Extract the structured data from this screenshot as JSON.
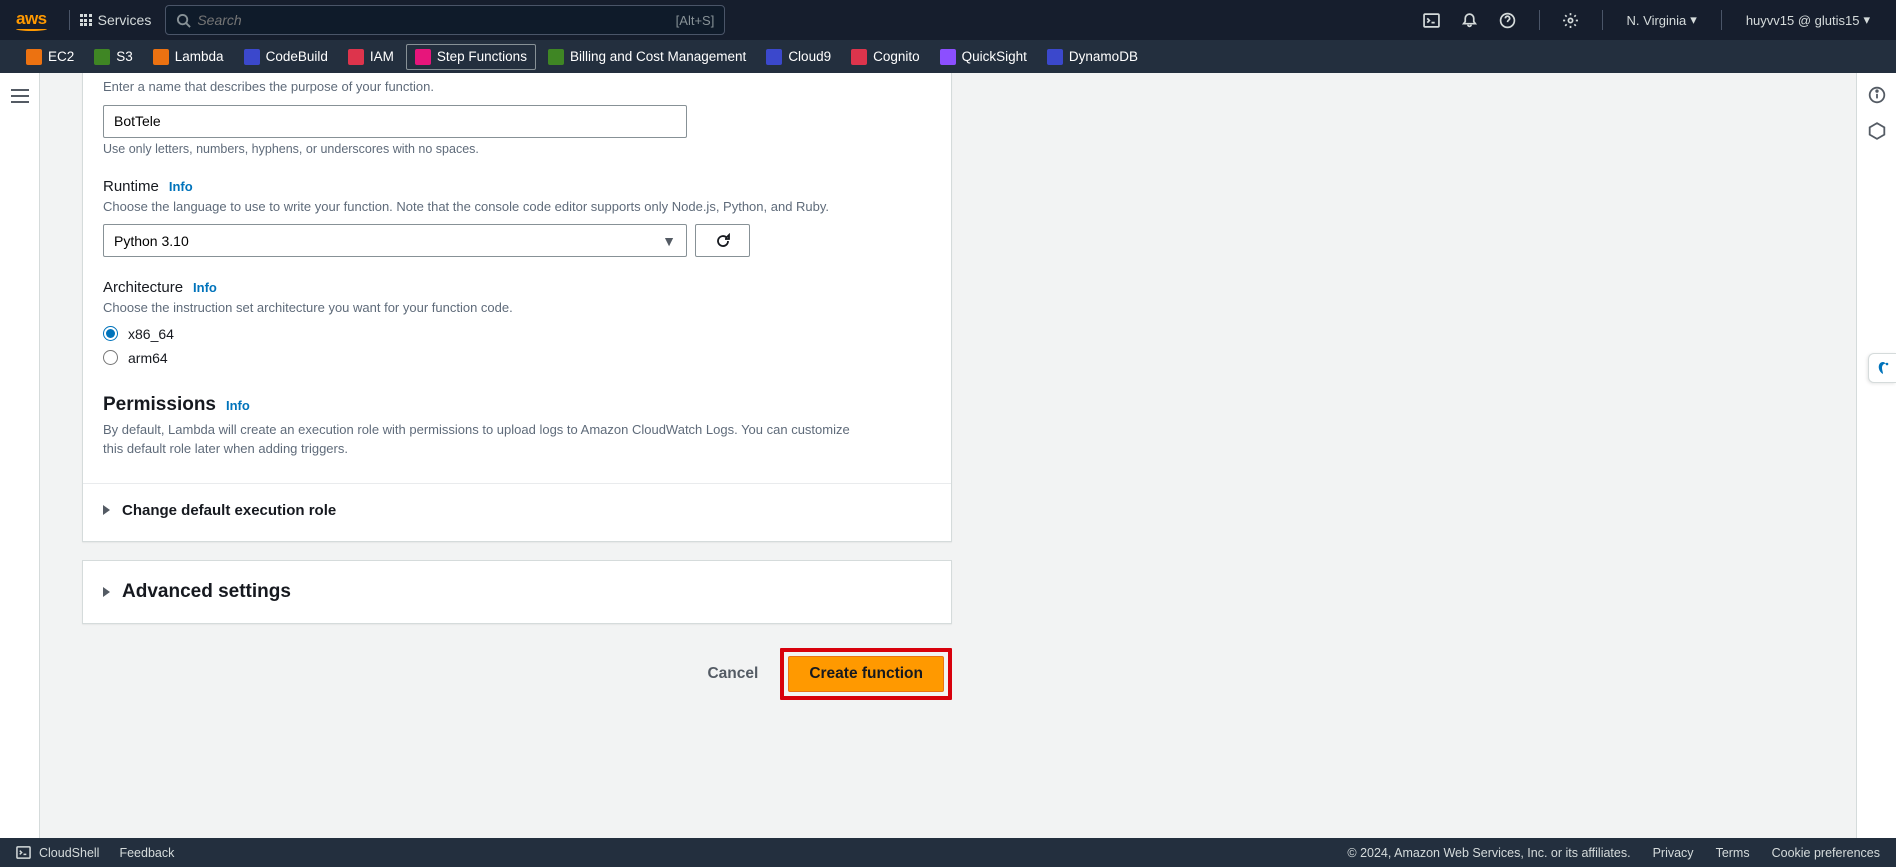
{
  "topnav": {
    "services": "Services",
    "search_placeholder": "Search",
    "search_hint": "[Alt+S]",
    "region": "N. Virginia",
    "account": "huyvv15 @ glutis15"
  },
  "secondnav": {
    "items": [
      "EC2",
      "S3",
      "Lambda",
      "CodeBuild",
      "IAM",
      "Step Functions",
      "Billing and Cost Management",
      "Cloud9",
      "Cognito",
      "QuickSight",
      "DynamoDB"
    ]
  },
  "form": {
    "name_helper_top": "Enter a name that describes the purpose of your function.",
    "name_value": "BotTele",
    "name_helper_bottom": "Use only letters, numbers, hyphens, or underscores with no spaces.",
    "runtime_label": "Runtime",
    "info": "Info",
    "runtime_desc": "Choose the language to use to write your function. Note that the console code editor supports only Node.js, Python, and Ruby.",
    "runtime_value": "Python 3.10",
    "arch_label": "Architecture",
    "arch_desc": "Choose the instruction set architecture you want for your function code.",
    "arch_x86": "x86_64",
    "arch_arm": "arm64",
    "perm_label": "Permissions",
    "perm_desc": "By default, Lambda will create an execution role with permissions to upload logs to Amazon CloudWatch Logs. You can customize this default role later when adding triggers.",
    "change_role": "Change default execution role",
    "advanced": "Advanced settings",
    "cancel": "Cancel",
    "create": "Create function"
  },
  "footer": {
    "cloudshell": "CloudShell",
    "feedback": "Feedback",
    "copyright": "© 2024, Amazon Web Services, Inc. or its affiliates.",
    "privacy": "Privacy",
    "terms": "Terms",
    "cookieprefs": "Cookie preferences"
  }
}
